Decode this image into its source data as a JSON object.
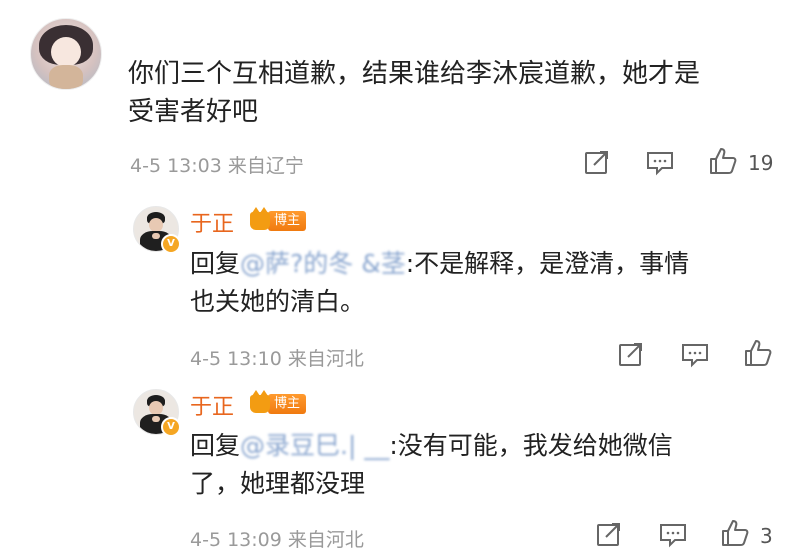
{
  "main_comment": {
    "text_line1": "你们三个互相道歉，结果谁给李沐宸道歉，她才是",
    "text_line2": "受害者好吧",
    "meta": "4-5 13:03 来自辽宁",
    "like_count": "19"
  },
  "replies": [
    {
      "author": "于正",
      "badge": "博主",
      "verified": "V",
      "reply_prefix": "回复",
      "mention": "@萨?的冬 &茎",
      "text_line1": ":不是解释，是澄清，事情",
      "text_line2": "也关她的清白。",
      "meta": "4-5 13:10 来自河北",
      "like_count": ""
    },
    {
      "author": "于正",
      "badge": "博主",
      "verified": "V",
      "reply_prefix": "回复",
      "mention": "@录豆巳.| __",
      "text_line1": ":没有可能，我发给她微信",
      "text_line2": "了，她理都没理",
      "meta": "4-5 13:09 来自河北",
      "like_count": "3"
    }
  ],
  "icons": [
    "share-icon",
    "comment-icon",
    "like-icon"
  ],
  "colors": {
    "author": "#e8661e",
    "mention": "#3a6fb5",
    "meta": "#9a9a9a",
    "badge": "#f39c12"
  }
}
